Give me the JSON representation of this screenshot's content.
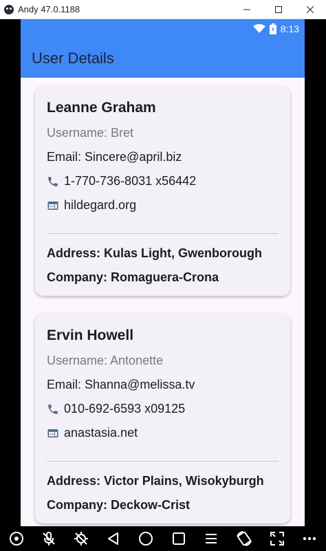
{
  "window": {
    "title": "Andy 47.0.1188"
  },
  "status_bar": {
    "time": "8:13"
  },
  "app_bar": {
    "title": "User Details"
  },
  "users": [
    {
      "name": "Leanne Graham",
      "username": "Username: Bret",
      "email": "Email: Sincere@april.biz",
      "phone": "1-770-736-8031 x56442",
      "website": "hildegard.org",
      "address": "Address: Kulas Light, Gwenborough",
      "company": "Company: Romaguera-Crona"
    },
    {
      "name": "Ervin Howell",
      "username": "Username: Antonette",
      "email": "Email: Shanna@melissa.tv",
      "phone": "010-692-6593 x09125",
      "website": "anastasia.net",
      "address": "Address: Victor Plains, Wisokyburgh",
      "company": "Company: Deckow-Crist"
    }
  ],
  "colors": {
    "app_bar": "#3f88f7",
    "card": "#f4f0f7",
    "background": "#fbf7fd",
    "icon": "#4e6a85"
  }
}
